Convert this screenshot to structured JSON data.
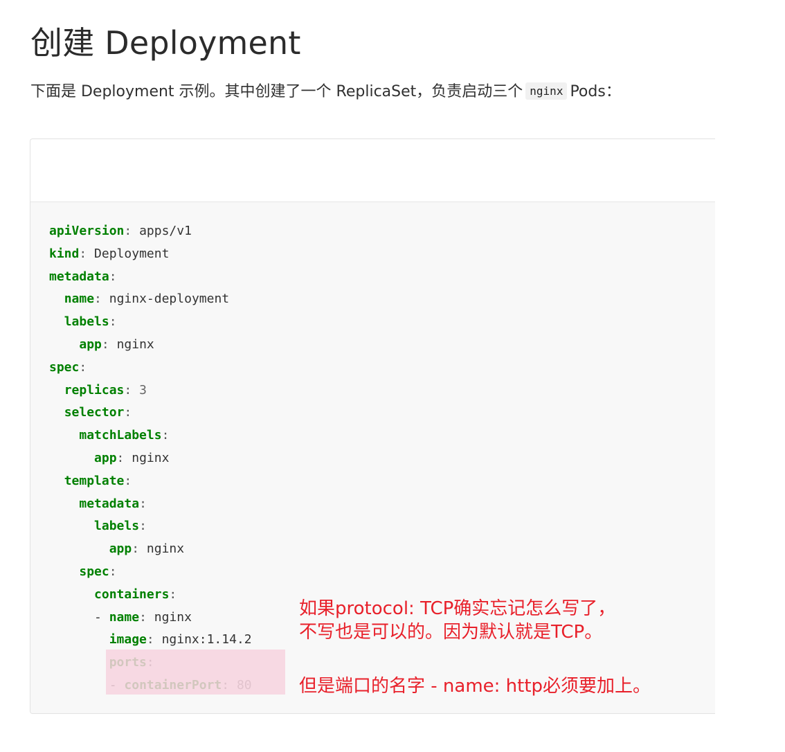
{
  "page": {
    "title": "创建 Deployment",
    "intro_before": "下面是 Deployment 示例。其中创建了一个 ReplicaSet，负责启动三个",
    "intro_code": "nginx",
    "intro_after": "Pods："
  },
  "code": {
    "lines": [
      {
        "indent": "",
        "dash": "",
        "key": "apiVersion",
        "value": "apps/v1",
        "type": "string"
      },
      {
        "indent": "",
        "dash": "",
        "key": "kind",
        "value": "Deployment",
        "type": "string"
      },
      {
        "indent": "",
        "dash": "",
        "key": "metadata",
        "value": "",
        "type": "string"
      },
      {
        "indent": "  ",
        "dash": "",
        "key": "name",
        "value": "nginx-deployment",
        "type": "string"
      },
      {
        "indent": "  ",
        "dash": "",
        "key": "labels",
        "value": "",
        "type": "string"
      },
      {
        "indent": "    ",
        "dash": "",
        "key": "app",
        "value": "nginx",
        "type": "string"
      },
      {
        "indent": "",
        "dash": "",
        "key": "spec",
        "value": "",
        "type": "string"
      },
      {
        "indent": "  ",
        "dash": "",
        "key": "replicas",
        "value": "3",
        "type": "number"
      },
      {
        "indent": "  ",
        "dash": "",
        "key": "selector",
        "value": "",
        "type": "string"
      },
      {
        "indent": "    ",
        "dash": "",
        "key": "matchLabels",
        "value": "",
        "type": "string"
      },
      {
        "indent": "      ",
        "dash": "",
        "key": "app",
        "value": "nginx",
        "type": "string"
      },
      {
        "indent": "  ",
        "dash": "",
        "key": "template",
        "value": "",
        "type": "string"
      },
      {
        "indent": "    ",
        "dash": "",
        "key": "metadata",
        "value": "",
        "type": "string"
      },
      {
        "indent": "      ",
        "dash": "",
        "key": "labels",
        "value": "",
        "type": "string"
      },
      {
        "indent": "        ",
        "dash": "",
        "key": "app",
        "value": "nginx",
        "type": "string"
      },
      {
        "indent": "    ",
        "dash": "",
        "key": "spec",
        "value": "",
        "type": "string"
      },
      {
        "indent": "      ",
        "dash": "",
        "key": "containers",
        "value": "",
        "type": "string"
      },
      {
        "indent": "      ",
        "dash": "- ",
        "key": "name",
        "value": "nginx",
        "type": "string"
      },
      {
        "indent": "        ",
        "dash": "",
        "key": "image",
        "value": "nginx:1.14.2",
        "type": "string"
      },
      {
        "indent": "        ",
        "dash": "",
        "key": "ports",
        "value": "",
        "type": "string"
      },
      {
        "indent": "        ",
        "dash": "- ",
        "key": "containerPort",
        "value": "80",
        "type": "number"
      }
    ]
  },
  "annotation": {
    "line1": "如果protocol: TCP确实忘记怎么写了，",
    "line2": "不写也是可以的。因为默认就是TCP。",
    "line3": "但是端口的名字 - name: http必须要加上。"
  },
  "colors": {
    "key": "#008000",
    "annotation": "#e8202a",
    "highlight": "#f7d3df",
    "code_background": "#f8f8f8"
  }
}
